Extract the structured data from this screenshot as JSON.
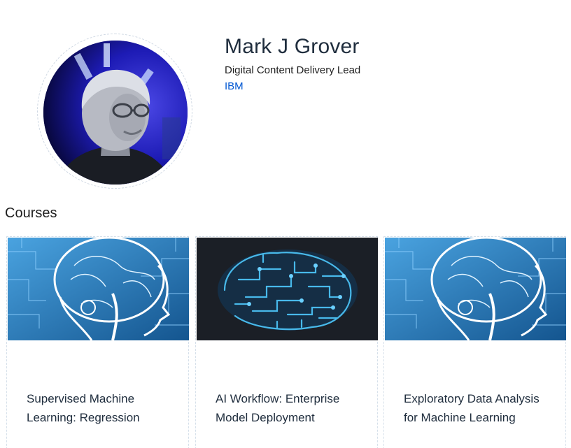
{
  "profile": {
    "name": "Mark J Grover",
    "title": "Digital Content Delivery Lead",
    "organization": "IBM",
    "avatar_icon": "instructor-photo"
  },
  "courses_section": {
    "heading": "Courses"
  },
  "courses": [
    {
      "title": "Supervised Machine Learning: Regression",
      "image_icon": "brain-circuit-image",
      "image_palette": "#2f7fc0"
    },
    {
      "title": "AI Workflow: Enterprise Model Deployment",
      "image_icon": "circuit-brain-image",
      "image_palette": "#1b1f26"
    },
    {
      "title": "Exploratory Data Analysis for Machine Learning",
      "image_icon": "brain-circuit-image",
      "image_palette": "#2f7fc0"
    }
  ],
  "colors": {
    "link": "#0056d2",
    "heading": "#1f2d3d"
  }
}
